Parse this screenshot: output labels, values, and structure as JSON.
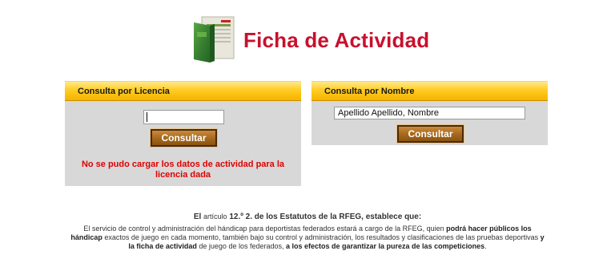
{
  "header": {
    "title": "Ficha de Actividad",
    "logo_icon": "activity-record-icon"
  },
  "licencia_panel": {
    "title": "Consulta por Licencia",
    "input_value": "",
    "button_label": "Consultar",
    "error_line1": "No se pudo cargar los datos de actividad para la",
    "error_line2": "licencia dada"
  },
  "nombre_panel": {
    "title": "Consulta por Nombre",
    "input_value": "Apellido Apellido, Nombre",
    "button_label": "Consultar"
  },
  "footer": {
    "heading_pre": "El ",
    "heading_small": "artículo",
    "heading_rest": " 12.º 2. de los Estatutos de la RFEG, establece que:",
    "p1": "El servicio de control y administración del hándicap para deportistas federados estará a cargo de la RFEG, quien ",
    "b1": "podrá hacer públicos los",
    "b2": "hándicap",
    "p2": " exactos de juego en cada momento, también bajo su control y administración, los resultados y clasificaciones de las pruebas deportivas ",
    "b3": "y",
    "b4": "la ficha de actividad",
    "p3": " de juego de los federados, ",
    "b5": "a los efectos de garantizar la pureza de las competiciones",
    "p4": "."
  },
  "colors": {
    "title_red": "#c8102e",
    "panel_header_gold": "#ffcc22",
    "panel_bg": "#d8d8d8",
    "button_brown": "#a86a1e",
    "error_red": "#e00000"
  }
}
